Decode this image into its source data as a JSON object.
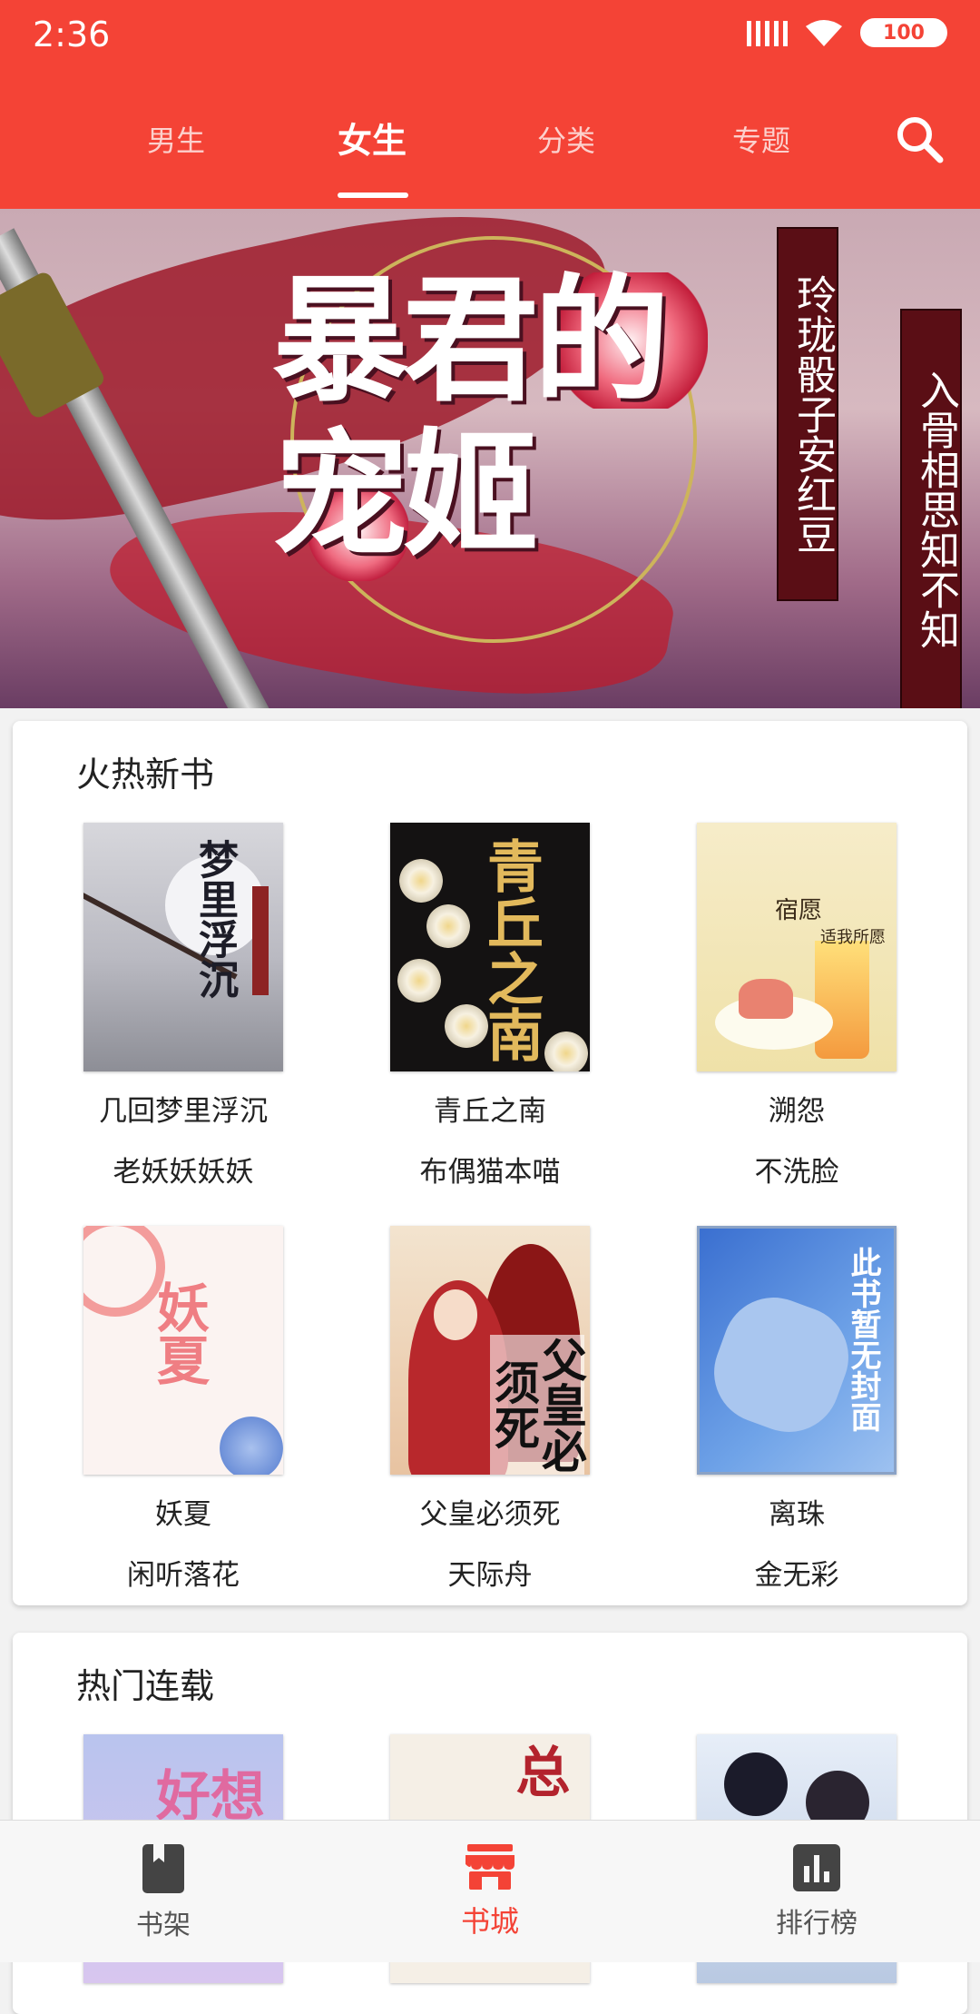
{
  "status_bar": {
    "time": "2:36",
    "battery": "100"
  },
  "tabs": [
    {
      "label": "男生"
    },
    {
      "label": "女生"
    },
    {
      "label": "分类"
    },
    {
      "label": "专题"
    }
  ],
  "banner": {
    "title": "暴君的宠姬",
    "tag_left": "玲珑骰子安红豆",
    "tag_right": "入骨相思知不知"
  },
  "section_new": {
    "title": "火热新书",
    "books": [
      {
        "name": "几回梦里浮沉",
        "author": "老妖妖妖妖",
        "cover_text": "梦里浮沉"
      },
      {
        "name": "青丘之南",
        "author": "布偶猫本喵",
        "cover_text": "青丘之南"
      },
      {
        "name": "溯怨",
        "author": "不洗脸",
        "cover_text_1": "宿愿",
        "cover_text_2": "适我所愿"
      },
      {
        "name": "妖夏",
        "author": "闲听落花",
        "cover_text": "妖夏"
      },
      {
        "name": "父皇必须死",
        "author": "天际舟",
        "cover_text": "父皇必须死"
      },
      {
        "name": "离珠",
        "author": "金无彩",
        "cover_text": "此书暂无封面"
      }
    ]
  },
  "section_serial": {
    "title": "热门连载",
    "covers": [
      {
        "cover_text": "好想"
      },
      {
        "cover_text": "总"
      },
      {
        "cover_text": ""
      }
    ]
  },
  "bottom_nav": [
    {
      "label": "书架"
    },
    {
      "label": "书城"
    },
    {
      "label": "排行榜"
    }
  ],
  "colors": {
    "accent": "#f44336",
    "background": "#f2f2f2"
  }
}
